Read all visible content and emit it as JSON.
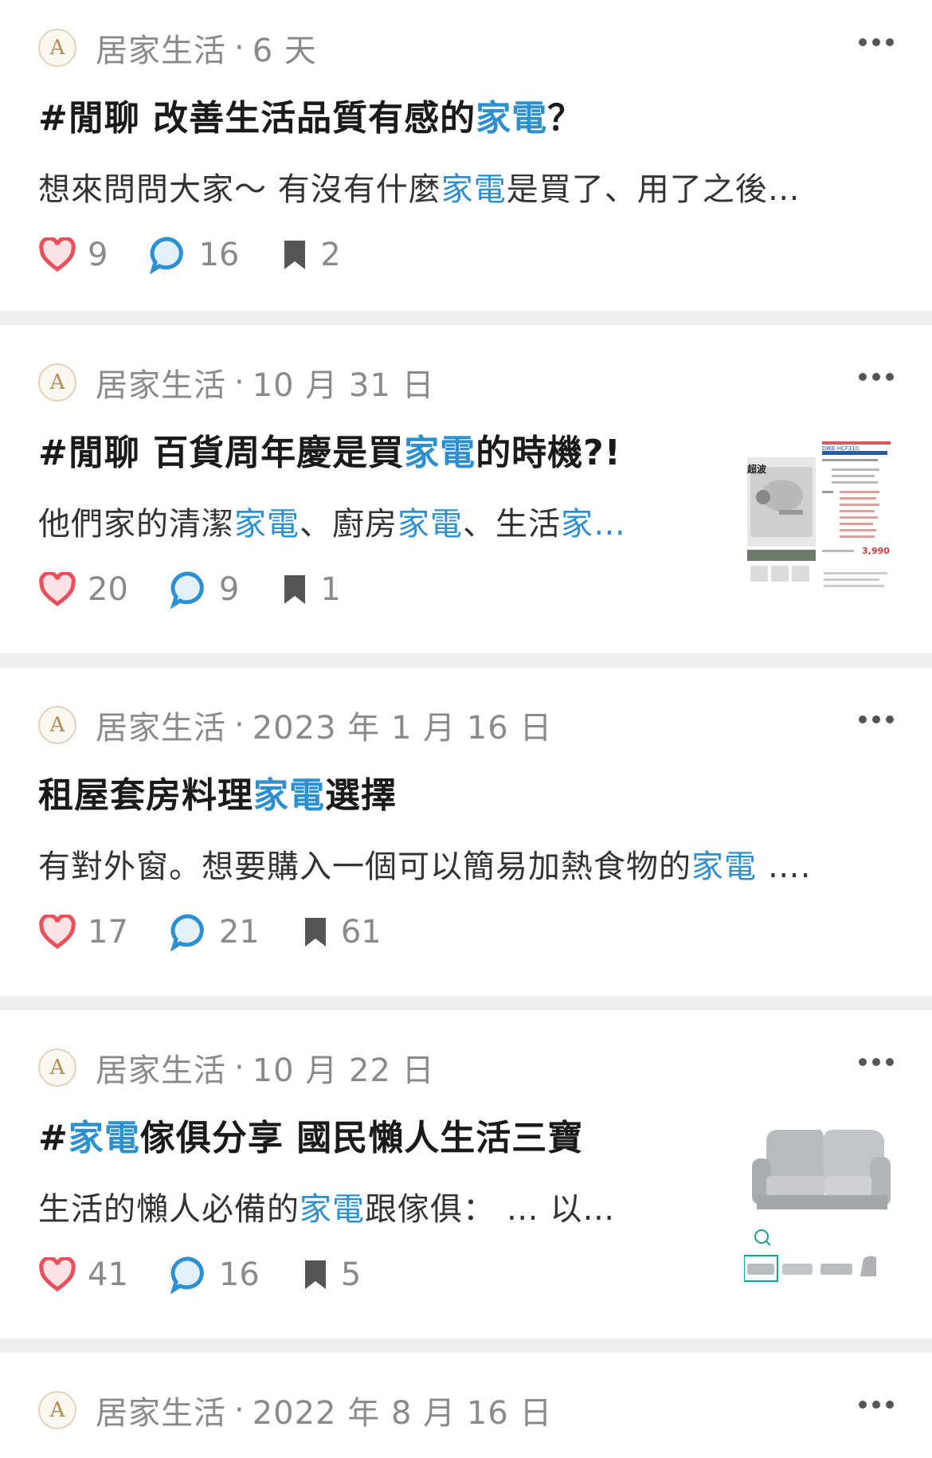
{
  "posts": [
    {
      "board": "居家生活",
      "date": "6 天",
      "title_parts": [
        {
          "text": "#閒聊 改善生活品質有感的",
          "hl": false
        },
        {
          "text": "家電",
          "hl": true
        },
        {
          "text": "？",
          "hl": false
        }
      ],
      "snippet_parts": [
        {
          "text": "想來問問大家～ 有沒有什麼",
          "hl": false
        },
        {
          "text": "家電",
          "hl": true
        },
        {
          "text": "是買了、用了之後…",
          "hl": false
        }
      ],
      "likes": "9",
      "comments": "16",
      "saves": "2",
      "has_thumb": false
    },
    {
      "board": "居家生活",
      "date": "10 月 31 日",
      "title_parts": [
        {
          "text": "#閒聊 百貨周年慶是買",
          "hl": false
        },
        {
          "text": "家電",
          "hl": true
        },
        {
          "text": "的時機?!",
          "hl": false
        }
      ],
      "snippet_parts": [
        {
          "text": "他們家的清潔",
          "hl": false
        },
        {
          "text": "家電",
          "hl": true
        },
        {
          "text": "、廚房",
          "hl": false
        },
        {
          "text": "家電",
          "hl": true
        },
        {
          "text": "、生活",
          "hl": false
        },
        {
          "text": "家…",
          "hl": true
        }
      ],
      "likes": "20",
      "comments": "9",
      "saves": "1",
      "has_thumb": true,
      "thumb": {
        "price": "3,990",
        "label": "DIKE HCF310",
        "side_text": "超波"
      }
    },
    {
      "board": "居家生活",
      "date": "2023 年 1 月 16 日",
      "title_parts": [
        {
          "text": "租屋套房料理",
          "hl": false
        },
        {
          "text": "家電",
          "hl": true
        },
        {
          "text": "選擇",
          "hl": false
        }
      ],
      "snippet_parts": [
        {
          "text": "有對外窗。想要購入一個可以簡易加熱食物的",
          "hl": false
        },
        {
          "text": "家電",
          "hl": true
        },
        {
          "text": " ….",
          "hl": false
        }
      ],
      "likes": "17",
      "comments": "21",
      "saves": "61",
      "has_thumb": false
    },
    {
      "board": "居家生活",
      "date": "10 月 22 日",
      "title_parts": [
        {
          "text": "#",
          "hl": false
        },
        {
          "text": "家電",
          "hl": true
        },
        {
          "text": "傢俱分享 國民懶人生活三寶",
          "hl": false
        }
      ],
      "snippet_parts": [
        {
          "text": "生活的懶人必備的",
          "hl": false
        },
        {
          "text": "家電",
          "hl": true
        },
        {
          "text": "跟傢俱： … 以…",
          "hl": false
        }
      ],
      "likes": "41",
      "comments": "16",
      "saves": "5",
      "has_thumb": true
    },
    {
      "board": "居家生活",
      "date": "2022 年 8 月 16 日",
      "has_thumb": false
    }
  ],
  "colors": {
    "highlight": "#2c8fd0",
    "heart": "#e8505b",
    "comment": "#2c8fd0",
    "bookmark": "#555555",
    "meta": "#8a8a8a",
    "separator": "#eeeeee"
  },
  "icons": [
    "avatar-logo",
    "more-icon",
    "heart-icon",
    "comment-icon",
    "bookmark-icon"
  ]
}
